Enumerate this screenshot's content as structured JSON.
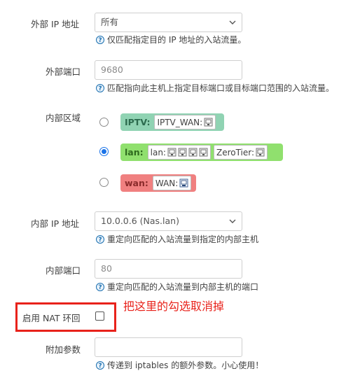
{
  "fields": {
    "external_ip": {
      "label": "外部 IP 地址",
      "value": "所有",
      "hint": "仅匹配指定目的 IP 地址的入站流量。"
    },
    "external_port": {
      "label": "外部端口",
      "value": "9680",
      "hint": "匹配指向此主机上指定目标端口或目标端口范围的入站流量。"
    },
    "internal_zone": {
      "label": "内部区域",
      "zones": [
        {
          "name": "IPTV:",
          "chips": [
            "IPTV_WAN:"
          ],
          "color": "#90d3b3",
          "checked": false
        },
        {
          "name": "lan:",
          "chips": [
            "lan:",
            "ZeroTier:"
          ],
          "color": "#90e06e",
          "checked": true
        },
        {
          "name": "wan:",
          "chips": [
            "WAN:"
          ],
          "color": "#f08080",
          "checked": false
        }
      ]
    },
    "internal_ip": {
      "label": "内部 IP 地址",
      "value": "10.0.0.6 (Nas.lan)",
      "hint": "重定向匹配的入站流量到指定的内部主机"
    },
    "internal_port": {
      "label": "内部端口",
      "value": "80",
      "hint": "重定向匹配的入站流量到内部主机的端口"
    },
    "nat_loopback": {
      "label": "启用 NAT 环回",
      "checked": false
    },
    "extra_args": {
      "label": "附加参数",
      "value": "",
      "hint": "传递到 iptables 的额外参数。小心使用！"
    }
  },
  "annotation": {
    "text": "把这里的勾选取消掉",
    "color": "#e8221b"
  },
  "icons": {
    "help": "question-circle-icon",
    "device": "network-device-icon",
    "chevron": "chevron-down-icon"
  }
}
